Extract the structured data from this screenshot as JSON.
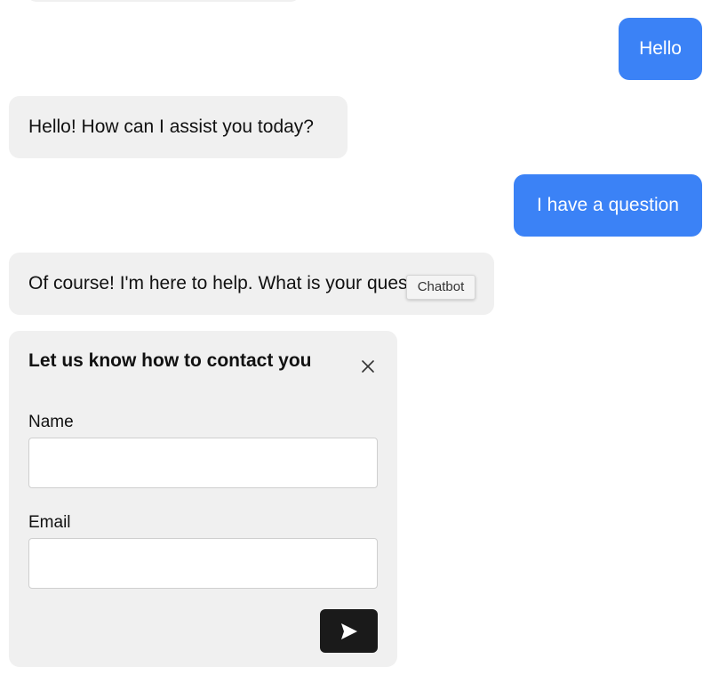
{
  "chat": {
    "messages": [
      {
        "role": "user",
        "text": "Hello"
      },
      {
        "role": "bot",
        "text": "Hello! How can I assist you today?"
      },
      {
        "role": "user",
        "text": "I have a question"
      },
      {
        "role": "bot",
        "text": "Of course! I'm here to help. What is your question?"
      }
    ],
    "tooltip": "Chatbot"
  },
  "contact_form": {
    "title": "Let us know how to contact you",
    "name_label": "Name",
    "name_value": "",
    "email_label": "Email",
    "email_value": ""
  },
  "icons": {
    "close": "close-icon",
    "send": "send-icon"
  },
  "colors": {
    "user_bubble": "#3b82f6",
    "bot_bubble": "#f0f0f0",
    "send_button": "#1a1a1a"
  }
}
